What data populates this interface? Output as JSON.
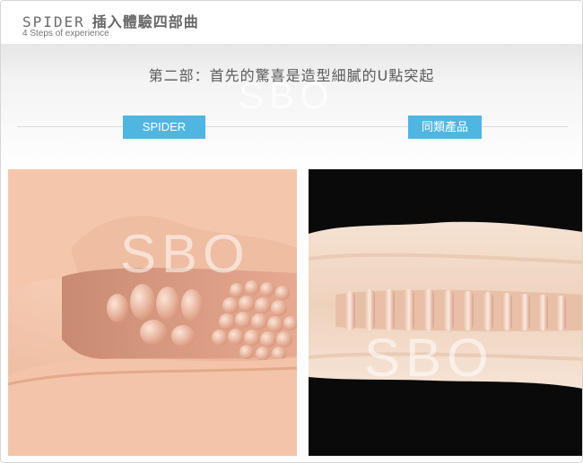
{
  "header": {
    "brand": "SPIDER",
    "title_cjk": "插入體驗四部曲",
    "subtitle": "4 Steps of experience"
  },
  "section": {
    "headline": "第二部：首先的驚喜是造型細膩的U點突起",
    "tabs": [
      {
        "label": "SPIDER"
      },
      {
        "label": "同類產品"
      }
    ]
  },
  "watermark": {
    "text": "SBO"
  },
  "colors": {
    "accent": "#4fb6e2",
    "skin": "#f2c3a8",
    "dark_bg": "#0a0a0a"
  }
}
